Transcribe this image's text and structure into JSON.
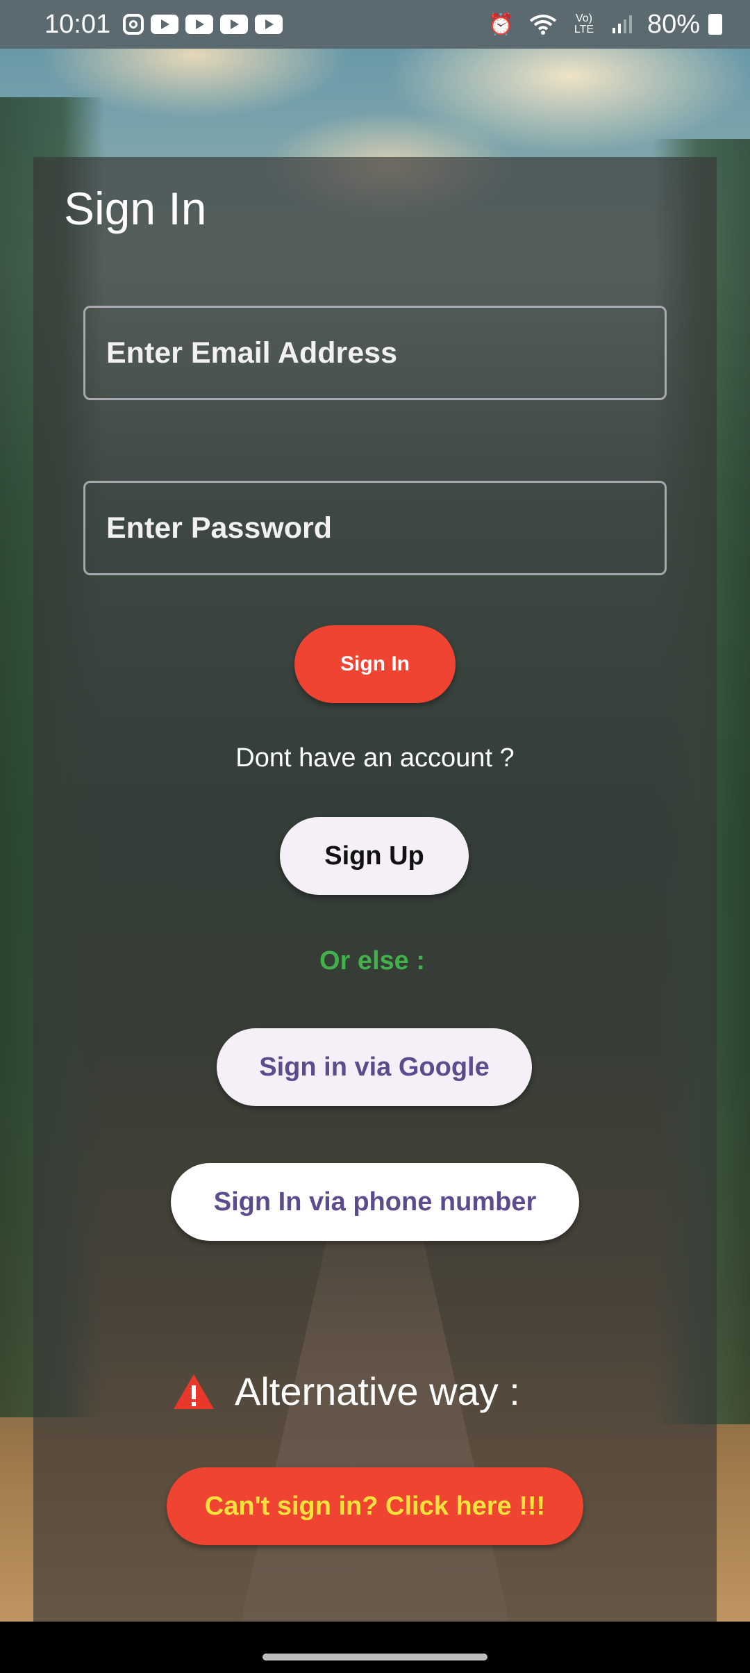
{
  "status_bar": {
    "time": "10:01",
    "battery": "80%",
    "left_icons": [
      "instagram-icon",
      "youtube-icon",
      "youtube-icon",
      "youtube-icon",
      "youtube-icon"
    ],
    "right_icons": [
      "alarm-icon",
      "wifi-icon",
      "volte-icon",
      "signal-icon",
      "battery-icon"
    ],
    "volte_label": "Vo) LTE"
  },
  "page": {
    "title": "Sign In"
  },
  "form": {
    "email_placeholder": "Enter Email Address",
    "email_value": "",
    "password_placeholder": "Enter Password",
    "password_value": ""
  },
  "buttons": {
    "sign_in": "Sign In",
    "sign_up": "Sign Up",
    "google": "Sign in via Google",
    "phone": "Sign In via phone number",
    "cant_sign_in": "Can't sign in? Click here !!!"
  },
  "texts": {
    "no_account": "Dont have an account ?",
    "or_else": "Or else :",
    "alternative": "Alternative way :"
  },
  "colors": {
    "primary_red": "#f04433",
    "accent_green": "#43b14b",
    "button_text_purple": "#5c4c8e",
    "warning_yellow": "#f7e23c"
  }
}
